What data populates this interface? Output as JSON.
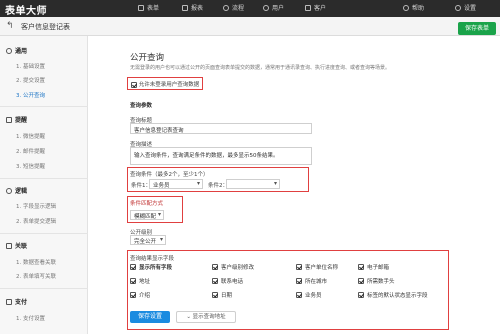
{
  "topbar": {
    "logo": "表单大师",
    "nav": [
      {
        "label": "表单",
        "icon": "form-icon"
      },
      {
        "label": "报表",
        "icon": "report-icon"
      },
      {
        "label": "流程",
        "icon": "flow-icon"
      },
      {
        "label": "用户",
        "icon": "user-icon"
      },
      {
        "label": "客户",
        "icon": "customer-icon"
      },
      {
        "label": "帮助",
        "icon": "help-icon"
      },
      {
        "label": "设置",
        "icon": "settings-icon"
      }
    ]
  },
  "subbar": {
    "back_icon": "↰",
    "title": "客户信息登记表",
    "save_label": "保存表单"
  },
  "sidebar": {
    "sections": [
      {
        "title": "通用",
        "icon": "general-icon",
        "items": [
          "1. 基础设置",
          "2. 提交设置",
          "3. 公开查询"
        ]
      },
      {
        "title": "提醒",
        "icon": "notify-icon",
        "items": [
          "1. 微信提醒",
          "2. 邮件提醒",
          "3. 短信提醒"
        ]
      },
      {
        "title": "逻辑",
        "icon": "logic-icon",
        "items": [
          "1. 字段显示逻辑",
          "2. 表单提交逻辑"
        ]
      },
      {
        "title": "关联",
        "icon": "link-icon",
        "items": [
          "1. 数据查看关联",
          "2. 表单填写关联"
        ]
      },
      {
        "title": "支付",
        "icon": "pay-icon",
        "items": [
          "1. 支付设置"
        ]
      }
    ],
    "active_item": "3. 公开查询"
  },
  "main": {
    "title": "公开查询",
    "description": "无需登录的用户也可以通过公开的页面查询表单提交的数据，通常用于通讯录查询、执行进度查询、或者查询等场景。",
    "allow_label": "允许未登录用户查询数据",
    "params_heading": "查询参数",
    "query_title_label": "查询标题",
    "query_title_value": "客户信息登记表查询",
    "query_desc_label": "查询描述",
    "query_desc_value": "输入查询条件，查询满足条件的数据，最多显示50条结果。",
    "conditions_label": "查询条件（最多2个，至少1个）",
    "condition1_label": "条件1：",
    "condition1_value": "业务员",
    "condition2_label": "条件2：",
    "condition2_value": "",
    "match_label": "条件匹配方式",
    "match_value": "模糊匹配",
    "public_label": "公开级别",
    "public_value": "完全公开",
    "result_fields_label": "查询结果显示字段",
    "result_fields": [
      [
        "显示所有字段",
        "客户级别修改",
        "客户单位名称",
        "电子邮箱"
      ],
      [
        "地址",
        "联系电话",
        "所在城市",
        "所需数手头"
      ],
      [
        "介绍",
        "日期",
        "业务员",
        "标签的默认状态显示字段"
      ]
    ],
    "save_button": "保存设置",
    "show_url_button": "显示查询地址"
  }
}
